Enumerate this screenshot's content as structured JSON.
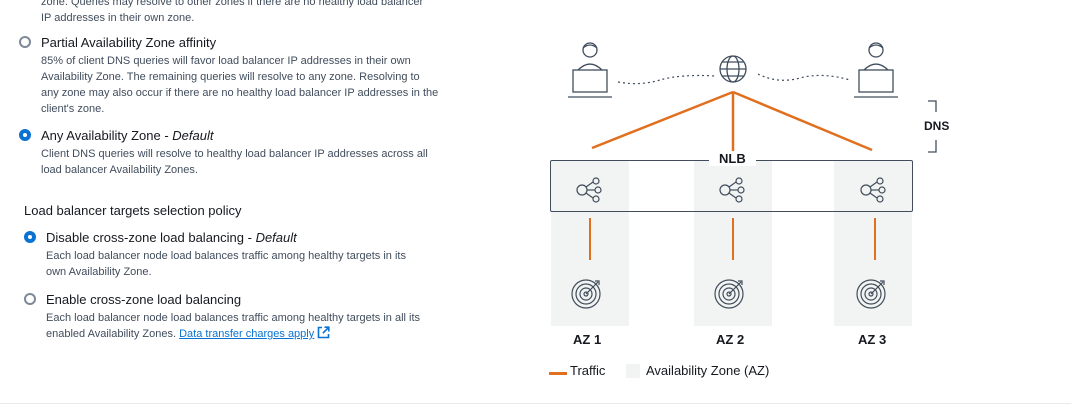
{
  "cut_off_text": {
    "line1": "zone. Queries may resolve to other zones if there are no healthy load balancer",
    "line2": "IP addresses in their own zone."
  },
  "dns_affinity_options": [
    {
      "label": "Partial Availability Zone affinity",
      "suffix": "",
      "checked": false,
      "desc1": "85% of client DNS queries will favor load balancer IP addresses in their own",
      "desc2": "Availability Zone. The remaining queries will resolve to any zone. Resolving to",
      "desc3": "any zone may also occur if there are no healthy load balancer IP addresses in the",
      "desc4": "client's zone."
    },
    {
      "label": "Any Availability Zone - ",
      "suffix": "Default",
      "checked": true,
      "desc1": "Client DNS queries will resolve to healthy load balancer IP addresses across all",
      "desc2": "load balancer Availability Zones."
    }
  ],
  "targets_policy": {
    "title": "Load balancer targets selection policy",
    "options": [
      {
        "label": "Disable cross-zone load balancing - ",
        "suffix": "Default",
        "checked": true,
        "desc1": "Each load balancer node load balances traffic among healthy targets in its",
        "desc2": "own Availability Zone."
      },
      {
        "label": "Enable cross-zone load balancing",
        "checked": false,
        "desc1": "Each load balancer node load balances traffic among healthy targets in all its",
        "desc2": "enabled Availability Zones. ",
        "link": "Data transfer charges apply"
      }
    ]
  },
  "diagram": {
    "nlb_label": "NLB",
    "dns_label": "DNS",
    "az_labels": [
      "AZ 1",
      "AZ 2",
      "AZ 3"
    ],
    "legend_traffic": "Traffic",
    "legend_az": "Availability Zone (AZ)",
    "colors": {
      "traffic": "#e07020",
      "az_fill": "#f2f3f3",
      "selected": "#0972d3"
    },
    "icons": [
      "user-icon",
      "globe-icon",
      "user-icon",
      "load-balancer-icon",
      "target-icon"
    ]
  }
}
